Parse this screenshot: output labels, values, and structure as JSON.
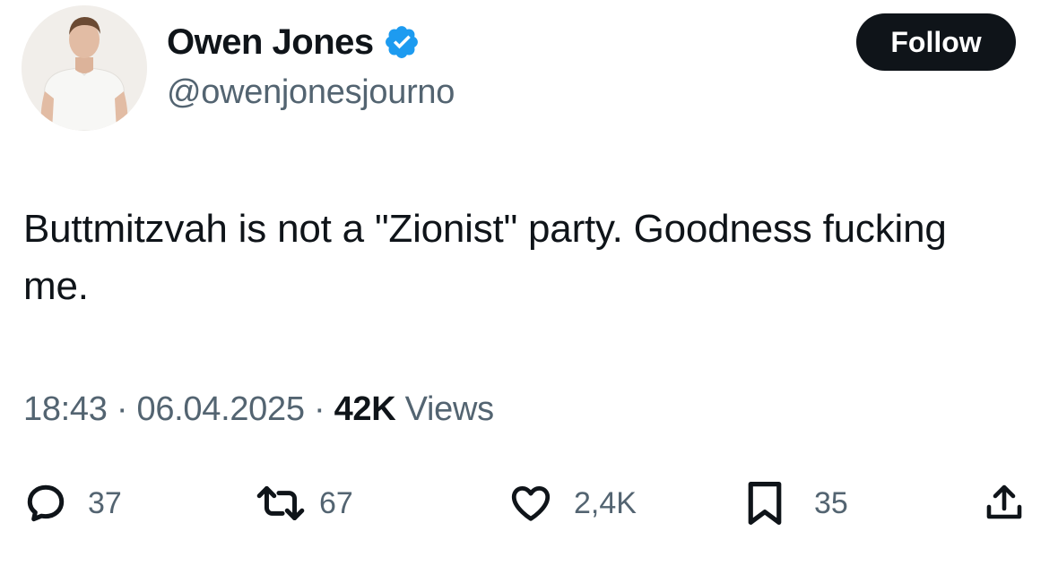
{
  "author": {
    "display_name": "Owen Jones",
    "handle": "@owenjonesjourno",
    "verified_icon": "verified-badge-icon",
    "avatar_icon": "avatar-photo"
  },
  "follow_button": {
    "label": "Follow"
  },
  "tweet": {
    "text": "Buttmitzvah is not a \"Zionist\" party. Goodness fucking me.",
    "time": "18:43",
    "date": "06.04.2025",
    "separator": "·",
    "views_count": "42K",
    "views_label": "Views"
  },
  "actions": {
    "replies": {
      "icon": "reply-icon",
      "count": "37"
    },
    "reposts": {
      "icon": "repost-icon",
      "count": "67"
    },
    "likes": {
      "icon": "heart-icon",
      "count": "2,4K"
    },
    "bookmarks": {
      "icon": "bookmark-icon",
      "count": "35"
    },
    "share": {
      "icon": "share-icon"
    }
  },
  "colors": {
    "text_primary": "#0f1419",
    "text_secondary": "#536471",
    "verified_blue": "#1d9bf0",
    "button_bg": "#0f1419",
    "background": "#ffffff"
  }
}
